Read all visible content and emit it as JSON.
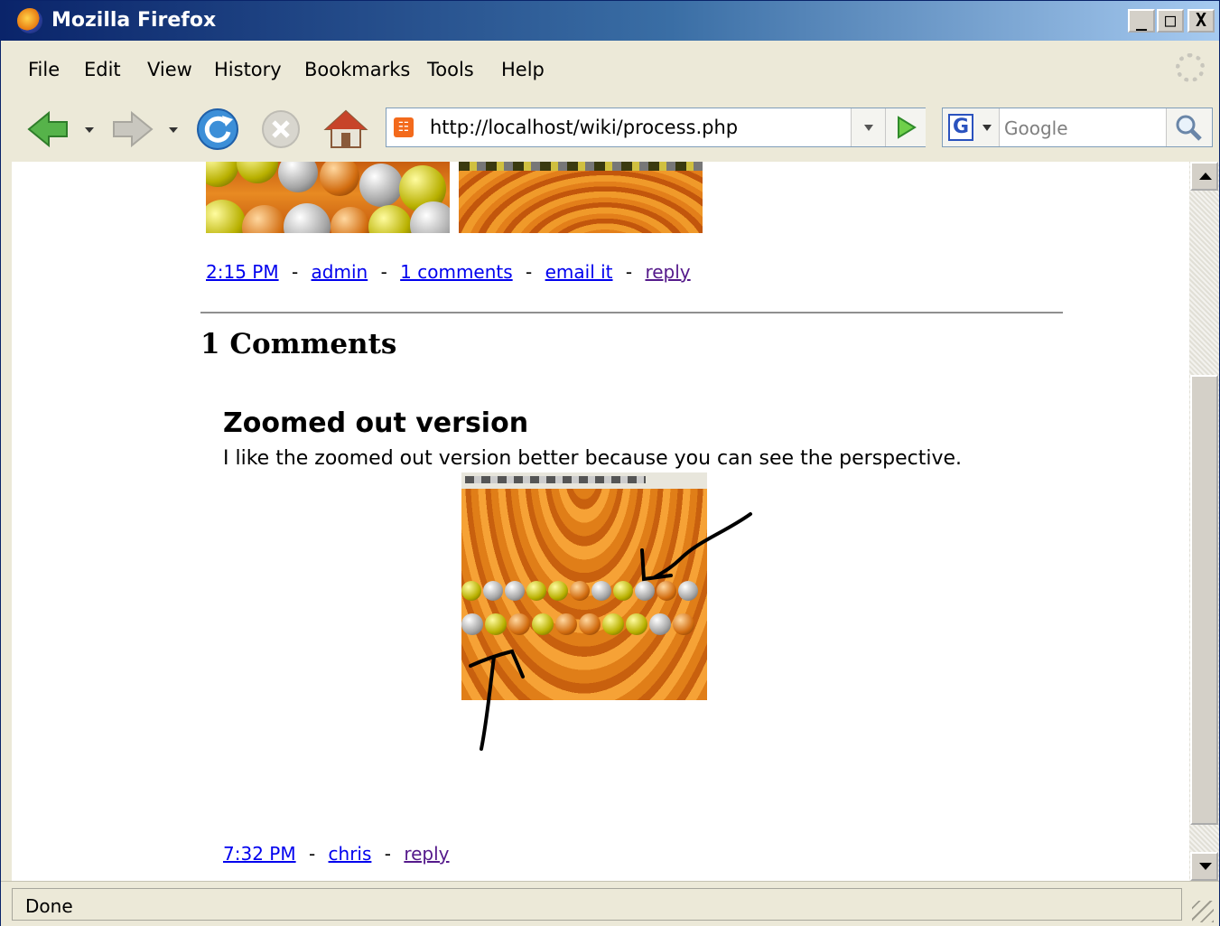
{
  "window": {
    "title": "Mozilla Firefox",
    "min": "_",
    "max": "□",
    "close": "X"
  },
  "menu": [
    "File",
    "Edit",
    "View",
    "History",
    "Bookmarks",
    "Tools",
    "Help"
  ],
  "toolbar": {
    "url": "http://localhost/wiki/process.php",
    "search_placeholder": "Google",
    "search_engine_letter": "G"
  },
  "post": {
    "time": "2:15 PM",
    "author": "admin",
    "comments_link": "1 comments",
    "email": "email it",
    "reply": "reply",
    "sep": "-"
  },
  "comments_heading": "1 Comments",
  "comment": {
    "title": "Zoomed out version",
    "body": "I like the zoomed out version better because you can see the perspective.",
    "time": "7:32 PM",
    "author": "chris",
    "reply": "reply",
    "sep": "-"
  },
  "status": {
    "text": "Done"
  },
  "colors": {
    "titlebar_start": "#0a246a",
    "link": "#0000ee",
    "visited": "#551a8b",
    "wood": "#e8861c"
  }
}
